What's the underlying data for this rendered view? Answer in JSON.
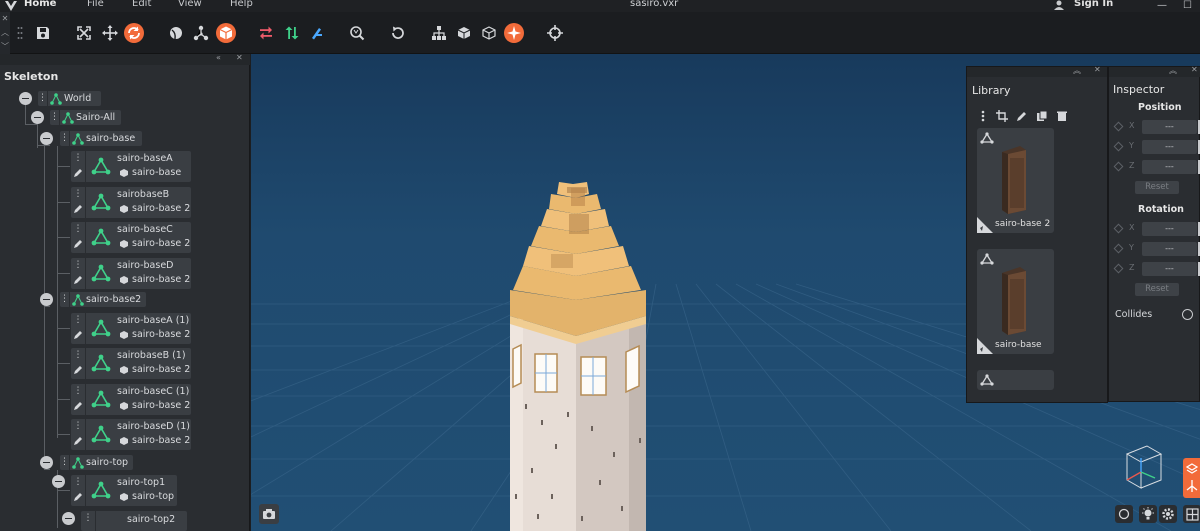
{
  "menu": {
    "home": "Home",
    "file": "File",
    "edit": "Edit",
    "view": "View",
    "help": "Help",
    "document_title": "sasiro.vxr",
    "sign_in": "Sign In",
    "minimize": "—",
    "maximize": "☐"
  },
  "skeleton": {
    "title": "Skeleton",
    "root": "World",
    "group": "Sairo-All",
    "sections": [
      {
        "name": "sairo-base",
        "items": [
          {
            "name": "sairo-baseA",
            "base": "sairo-base"
          },
          {
            "name": "sairobaseB",
            "base": "sairo-base 2"
          },
          {
            "name": "sairo-baseC",
            "base": "sairo-base 2"
          },
          {
            "name": "sairo-baseD",
            "base": "sairo-base 2"
          }
        ]
      },
      {
        "name": "sairo-base2",
        "items": [
          {
            "name": "sairo-baseA (1)",
            "base": "sairo-base 2"
          },
          {
            "name": "sairobaseB (1)",
            "base": "sairo-base 2"
          },
          {
            "name": "sairo-baseC (1)",
            "base": "sairo-base 2"
          },
          {
            "name": "sairo-baseD (1)",
            "base": "sairo-base 2"
          }
        ]
      },
      {
        "name": "sairo-top",
        "items": [
          {
            "name": "sairo-top1",
            "base": "sairo-top"
          },
          {
            "name": "sairo-top2",
            "base": ""
          }
        ]
      }
    ]
  },
  "library": {
    "title": "Library",
    "items": [
      {
        "name": "sairo-base 2"
      },
      {
        "name": "sairo-base"
      }
    ]
  },
  "inspector": {
    "title": "Inspector",
    "position_label": "Position",
    "rotation_label": "Rotation",
    "axes": [
      "X",
      "Y",
      "Z"
    ],
    "position_values": [
      "---",
      "---",
      "---"
    ],
    "rotation_values": [
      "---",
      "---",
      "---"
    ],
    "reset_label": "Reset",
    "collides_label": "Collides"
  },
  "colors": {
    "accent": "#f26b3a",
    "tree_icon_green": "#3fd18a",
    "viewport_top": "#183a5c",
    "viewport_bottom": "#214f74"
  }
}
